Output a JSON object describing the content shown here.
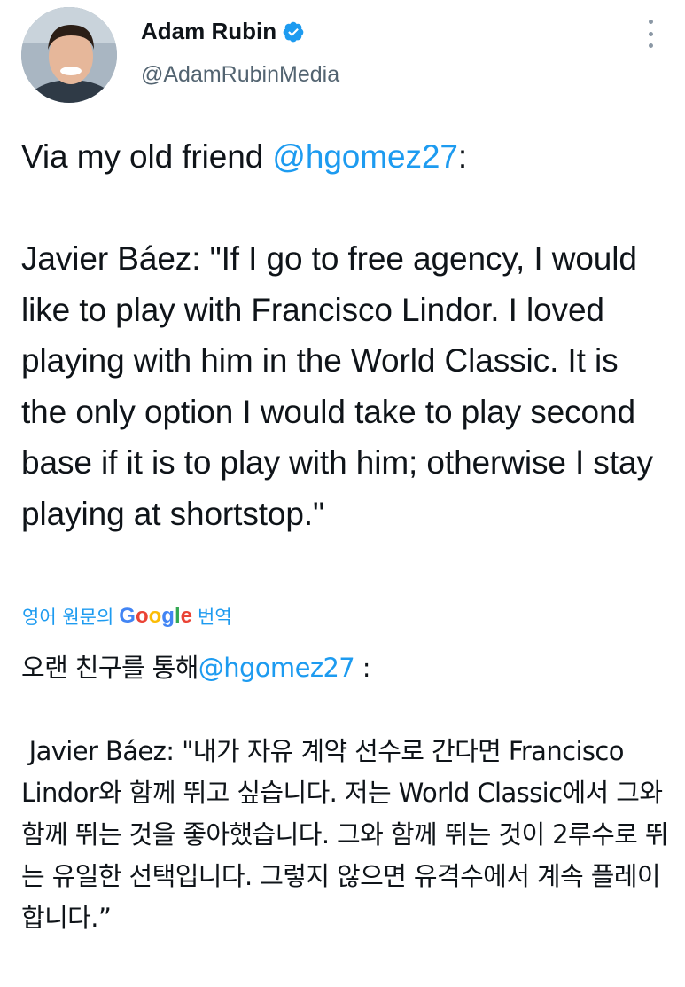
{
  "author": {
    "name": "Adam Rubin",
    "handle": "@AdamRubinMedia",
    "verified": true,
    "avatar_icon": "profile-photo-avatar"
  },
  "icons": {
    "verified": "verified-badge-icon",
    "more": "more-options-icon"
  },
  "colors": {
    "link": "#1d9bf0",
    "text": "#0f1419",
    "secondary": "#536471"
  },
  "tweet": {
    "intro_prefix": "Via my old friend ",
    "intro_mention": "@hgomez27",
    "intro_suffix": ":",
    "quote": "Javier Báez: \"If I go to free agency, I would like to play with Francisco Lindor. I loved playing with him in the World Classic. It is the only option I would take to play second base if it is to play with him; otherwise I stay playing at shortstop.\""
  },
  "translation": {
    "prefix": "영어 원문의",
    "brand": "Google",
    "suffix": "번역",
    "intro_prefix": "오랜 친구를 통해",
    "intro_mention": "@hgomez27",
    "intro_suffix": " :",
    "quote": " Javier Báez: \"내가 자유 계약 선수로 간다면 Francisco Lindor와 함께 뛰고 싶습니다. 저는 World Classic에서 그와 함께 뛰는 것을 좋아했습니다. 그와 함께 뛰는 것이 2루수로 뛰는 유일한 선택입니다. 그렇지 않으면 유격수에서 계속 플레이합니다.”"
  }
}
